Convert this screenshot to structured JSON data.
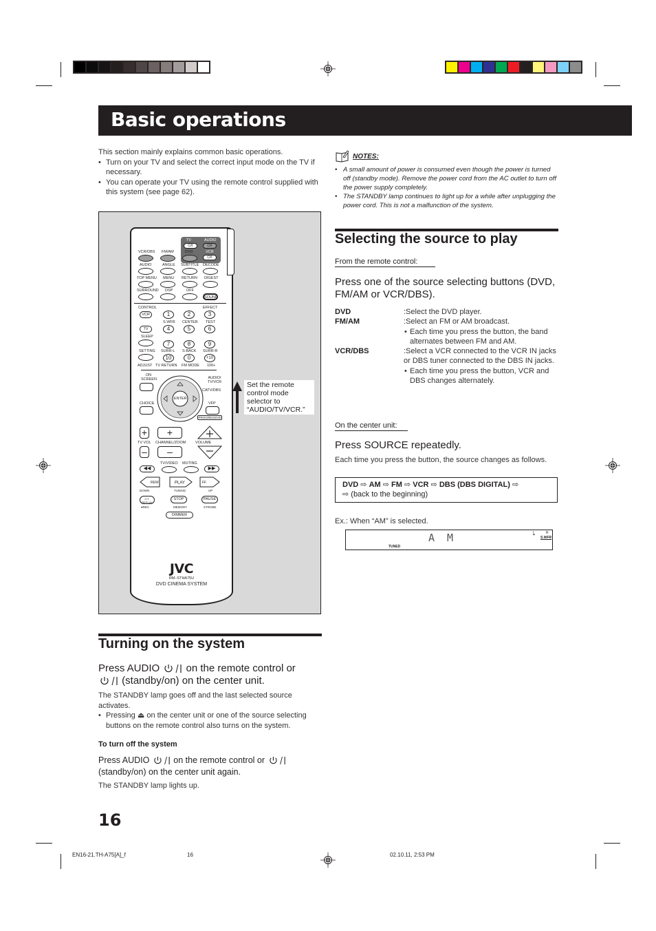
{
  "print_marks": {
    "gray_swatches": [
      "#000000",
      "#0c0b0b",
      "#161414",
      "#221f1e",
      "#352e2d",
      "#4f4747",
      "#6b6160",
      "#857c7c",
      "#a39c9c",
      "#d2cbcb",
      "#ffffff"
    ],
    "color_swatches": [
      "#fff200",
      "#ec008c",
      "#00aeef",
      "#2e3192",
      "#00a651",
      "#ed1c24",
      "#231f20",
      "#fff57a",
      "#f49ac1",
      "#7dd3f7",
      "#8c8c8c"
    ]
  },
  "header": {
    "title": "Basic operations"
  },
  "intro": {
    "text": "This section mainly explains common basic operations.",
    "bullets": [
      "Turn on your TV and select the correct input mode on the TV if necessary.",
      "You can operate your TV using the remote control supplied with this system (see page 62)."
    ]
  },
  "notes": {
    "heading": "NOTES:",
    "items": [
      "A small amount of power is consumed even though the power is turned off (standby mode). Remove the power cord from the AC outlet to turn off the power supply completely.",
      "The STANDBY lamp continues to light up for a while after unplugging the power cord. This is not a malfunction of the system."
    ]
  },
  "remote": {
    "labels": {
      "tv": "TV",
      "audio_top": "AUDIO",
      "vcr_top": "VCR",
      "power": "⏻/I",
      "vcr_dbs": "VCR/DBS",
      "fm_am": "FM/AM",
      "dvd": "DVD",
      "audio": "AUDIO",
      "angle": "ANGLE",
      "subtitle": "SUBTITLE",
      "decode": "DECODE",
      "top_menu": "TOP MENU",
      "menu": "MENU",
      "return": "RETURN",
      "digest": "DIGEST",
      "surround": "SURROUND",
      "dsp": "DSP",
      "off": "OFF",
      "sound": "SOUND",
      "control": "CONTROL",
      "effect": "EFFECT",
      "vcr_btn": "VCR",
      "tv_btn": "TV",
      "swfr": "S.WFR",
      "center": "CENTER",
      "test": "TEST",
      "sleep": "SLEEP",
      "setting": "SETTING",
      "surr_l": "SURR-L",
      "s_back": "S-BACK",
      "surr_r": "SURR-R",
      "adjust": "ADJUST",
      "tv_return": "TV RETURN",
      "fm_mode": "FM MODE",
      "hundred": "100+",
      "on_screen": "ON SCREEN",
      "audio_tv_vcr": "AUDIO/ TV/VCR",
      "catv_dbs": "CATV/DBS",
      "enter": "ENTER",
      "choice": "CHOICE",
      "vfp": "VFP",
      "progressive": "PROGRESSIVE",
      "tv_vol": "TV VOL",
      "channel_zoom": "CHANNEL/ZOOM",
      "volume": "VOLUME",
      "tv_video": "TV/VIDEO",
      "muting": "MUTING",
      "rew": "REW",
      "play": "PLAY",
      "ff": "FF",
      "down": "DOWN",
      "tuning": "TUNING",
      "up": "UP",
      "ot_replay": "O.T. REPLAY",
      "stop": "STOP",
      "pause": "PAUSE",
      "rec": "●REC",
      "memory": "MEMORY",
      "strobe": "STROBE",
      "dimmer": "DIMMER",
      "brand": "JVC",
      "model": "RM–STHA75U",
      "product": "DVD CINEMA SYSTEM"
    },
    "numbers": [
      "1",
      "2",
      "3",
      "4",
      "5",
      "6",
      "7",
      "8",
      "9",
      "10",
      "0",
      "+10"
    ],
    "callout": "Set the remote control mode selector to “AUDIO/TV/VCR.”"
  },
  "selecting": {
    "title": "Selecting the source to play",
    "remote_sub": "From the remote control:",
    "remote_step": "Press one of the source selecting buttons (DVD, FM/AM or VCR/DBS).",
    "defs": [
      {
        "term": "DVD",
        "desc": ":Select the DVD player.",
        "note": ""
      },
      {
        "term": "FM/AM",
        "desc": ":Select an FM or AM broadcast.",
        "note": "Each time you press the button, the band alternates between FM and AM."
      },
      {
        "term": "VCR/DBS",
        "desc": ":Select a VCR connected to the VCR IN jacks or DBS tuner connected to the DBS IN jacks.",
        "note": "Each time you press the button, VCR and DBS changes alternately."
      }
    ],
    "unit_sub": "On the center unit:",
    "unit_step": "Press SOURCE repeatedly.",
    "unit_body": "Each time you press the button, the source changes as follows.",
    "sequence": [
      "DVD",
      "AM",
      "FM",
      "VCR",
      "DBS (DBS DIGITAL)"
    ],
    "sequence_arrow": "⇨",
    "sequence_tail": "(back to the beginning)",
    "example_label": "Ex.: When “AM” is selected.",
    "display": {
      "chars": "AM",
      "tuned": "TUNED",
      "l": "L",
      "r": "R",
      "swfr": "S.WFR"
    }
  },
  "turning_on": {
    "title": "Turning on the system",
    "step_a": "Press AUDIO",
    "step_b": "on the remote control or",
    "step_c": "(standby/on) on the center unit.",
    "body": "The STANDBY lamp goes off and the last selected source activates.",
    "bullet_a": "Pressing",
    "bullet_b": "on the center unit or one of the source selecting buttons on the remote control also turns on the system.",
    "off_heading": "To turn off the system",
    "off_a": "Press AUDIO",
    "off_b": "on the remote control or",
    "off_c": "(standby/on) on the center unit again.",
    "off_body": "The STANDBY lamp lights up."
  },
  "page_number": "16",
  "footer": {
    "file": "EN16-21.TH-A75[A]_f",
    "page": "16",
    "date": "02.10.11, 2:53 PM"
  }
}
